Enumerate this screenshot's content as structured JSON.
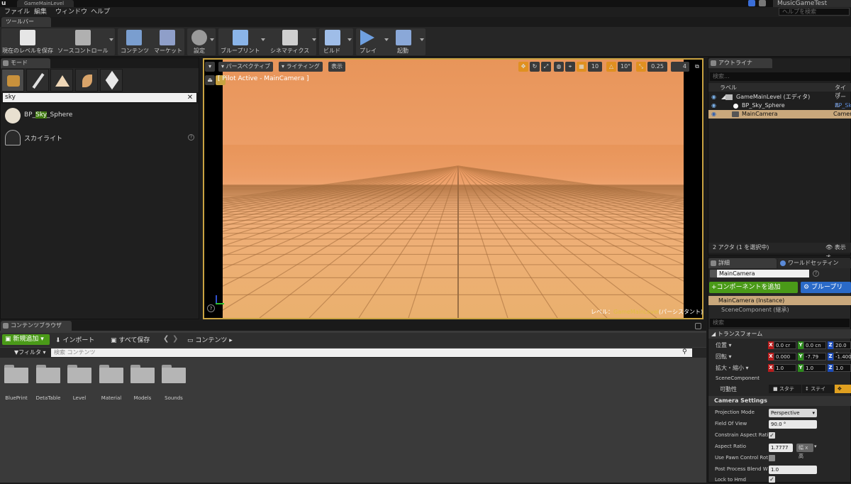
{
  "title_bar": {
    "level_tab": "GameMainLevel",
    "project": "MusicGameTest"
  },
  "menu": {
    "items": [
      "ファイル",
      "編集",
      "ウィンドウ",
      "ヘルプ"
    ],
    "help_search_placeholder": "ヘルプを検索"
  },
  "toolbar": {
    "tab_label": "ツールバー",
    "buttons": [
      {
        "label": "現在のレベルを保存",
        "icon": "save-icon"
      },
      {
        "label": "ソースコントロール",
        "icon": "source-control-icon"
      },
      {
        "label": "コンテンツ",
        "icon": "content-icon"
      },
      {
        "label": "マーケット",
        "icon": "marketplace-icon"
      },
      {
        "label": "設定",
        "icon": "settings-icon"
      },
      {
        "label": "ブループリント",
        "icon": "blueprint-icon"
      },
      {
        "label": "シネマティクス",
        "icon": "cinematics-icon"
      },
      {
        "label": "ビルド",
        "icon": "build-icon"
      },
      {
        "label": "プレイ",
        "icon": "play-icon"
      },
      {
        "label": "起動",
        "icon": "launch-icon"
      }
    ]
  },
  "modes": {
    "tab_label": "モード",
    "search_value": "sky",
    "items": [
      {
        "label_pre": "BP_",
        "label_hl": "Sky",
        "label_post": "_Sphere",
        "icon": "sky-sphere-icon"
      },
      {
        "label": "スカイライト",
        "icon": "skylight-icon"
      }
    ]
  },
  "viewport": {
    "perspective": "パースペクティブ",
    "lighting": "ライティング",
    "show": "表示",
    "pilot_label": "[ Pilot Active - MainCamera ]",
    "grid_snap": "10",
    "rot_snap": "10°",
    "scale_snap": "0.25",
    "cam_speed": "4",
    "level_label": "レベル：",
    "level_name": "GameMainLevel",
    "level_suffix": "(パーシスタント)"
  },
  "outliner": {
    "tab_label": "アウトライナ",
    "search_placeholder": "検索...",
    "col_label": "ラベル",
    "col_type": "タイプ",
    "rows": [
      {
        "label": "GameMainLevel (エディタ)",
        "type": "ワール"
      },
      {
        "label": "BP_Sky_Sphere",
        "type": "BP_Sk"
      },
      {
        "label": "MainCamera",
        "type": "Camera"
      }
    ],
    "status": "2 アクタ (1 を選択中)",
    "view_options": "表示オ"
  },
  "details": {
    "tab_details": "詳細",
    "tab_world": "ワールドセッティン",
    "name_value": "MainCamera",
    "add_component": "+コンポーネントを追加",
    "blueprint_btn": "ブループリ",
    "instance_label": "MainCamera (Instance)",
    "scene_component_row": "SceneComponent (継承)",
    "search_placeholder": "検索",
    "transform_header": "トランスフォーム",
    "location_label": "位置",
    "rotation_label": "回転",
    "scale_label": "拡大・縮小",
    "location": [
      "0.0 cr",
      "0.0 cn",
      "20.0 c"
    ],
    "rotation": [
      "0.000",
      "-7.79",
      "-1.400"
    ],
    "scale": [
      "1.0",
      "1.0",
      "1.0"
    ],
    "scene_component": "SceneComponent",
    "mobility_label": "可動性",
    "mobility_static": "スタテ",
    "mobility_stationary": "ステイ",
    "camera_settings": "Camera Settings",
    "projection_mode_label": "Projection Mode",
    "projection_mode_value": "Perspective",
    "fov_label": "Field Of View",
    "fov_value": "90.0 °",
    "constrain_label": "Constrain Aspect Rati",
    "aspect_label": "Aspect Ratio",
    "aspect_value": "1.7777",
    "aspect_preset": "幅 x 高",
    "pawn_label": "Use Pawn Control Rot",
    "ppbw_label": "Post Process Blend W",
    "ppbw_value": "1.0",
    "lock_label": "Lock to Hmd"
  },
  "content_browser": {
    "tab_label": "コンテンツブラウザ",
    "add_new": "新規追加",
    "import": "インポート",
    "save_all": "すべて保存",
    "path": "コンテンツ",
    "filter": "フィルタ",
    "search_placeholder": "検索 コンテンツ",
    "folders": [
      "BluePrint",
      "DetaTable",
      "Level",
      "Material",
      "Models",
      "Sounds"
    ]
  }
}
